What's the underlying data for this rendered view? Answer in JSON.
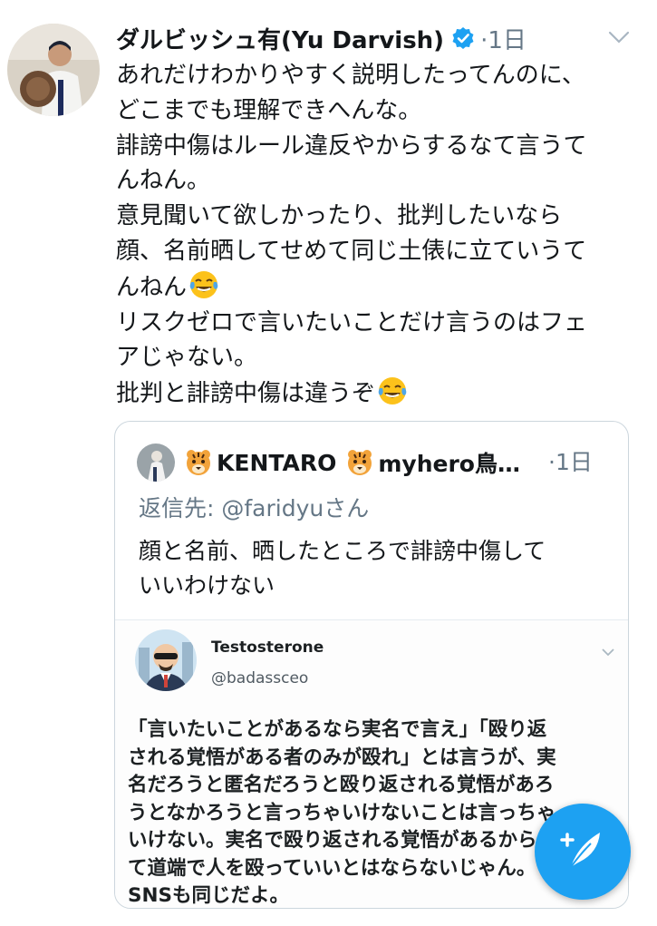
{
  "tweet": {
    "author": {
      "name": "ダルビッシュ有(Yu Darvish)",
      "verified": true
    },
    "separator": "·",
    "time": "1日",
    "lines": [
      "あれだけわかりやすく説明したってんのに、",
      "どこまでも理解できへんな。",
      "誹謗中傷はルール違反やからするなて言うて",
      "んねん。",
      "意見聞いて欲しかったり、批判したいなら",
      "顔、名前晒してせめて同じ土俵に立ていうて",
      "んねん",
      "リスクゼロで言いたいことだけ言うのはフェ",
      "アじゃない。",
      "批判と誹謗中傷は違うぞ"
    ],
    "emoji_after_lines": [
      "tears-of-joy-emoji",
      "tears-of-joy-emoji"
    ]
  },
  "quote": {
    "name": "KENTARO",
    "handle_truncated": "myhero鳥…",
    "separator": "·",
    "time": "1日",
    "reply_to": "返信先: @faridyuさん",
    "lines": [
      "顔と名前、晒したところで誹謗中傷して",
      "いいわけない"
    ],
    "embedded": {
      "name": "Testosterone",
      "handle": "@badassceo",
      "lines": [
        "「言いたいことがあるなら実名で言え」「殴り返",
        "される覚悟がある者のみが殴れ」とは言うが、実",
        "名だろうと匿名だろうと殴り返される覚悟があろ",
        "うとなかろうと言っちゃいけないことは言っちゃ",
        "いけない。実名で殴り返される覚悟があるからっ",
        "て道端で人を殴っていいとはならないじゃん。",
        "SNSも同じだよ。"
      ]
    }
  },
  "colors": {
    "accent": "#1da1f2",
    "text": "#14171a",
    "muted": "#657786"
  },
  "icons": [
    "verified-badge-icon",
    "chevron-down-icon",
    "tiger-emoji",
    "compose-tweet-icon"
  ]
}
